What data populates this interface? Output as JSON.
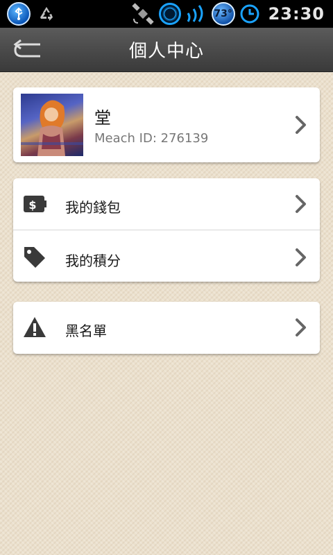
{
  "status_bar": {
    "time": "23:30",
    "temperature": "73°",
    "icons": [
      "usb-icon",
      "recycle-icon",
      "satellite-icon",
      "aperture-icon",
      "signal-icon",
      "temperature-icon",
      "clock-icon"
    ]
  },
  "header": {
    "title": "個人中心",
    "back_icon": "back-arrow-icon"
  },
  "profile": {
    "name": "堂",
    "id_text": "Meach ID: 276139"
  },
  "menu": {
    "wallet_label": "我的錢包",
    "points_label": "我的積分",
    "blacklist_label": "黑名單"
  },
  "colors": {
    "background": "#ebe0cd",
    "header": "#4a4a4a",
    "card": "#ffffff",
    "icon": "#3a3a3a",
    "chevron": "#666666"
  }
}
